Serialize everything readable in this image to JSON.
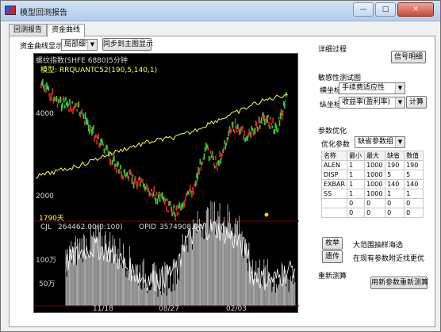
{
  "window": {
    "title": "模型回测报告",
    "minimize": "—",
    "maximize": "□",
    "close": "✕"
  },
  "tabs": [
    {
      "label": "回测报告"
    },
    {
      "label": "资金曲线"
    }
  ],
  "toolbar": {
    "display_label": "资金曲线显示",
    "display_select": "局部细节",
    "sync_button": "同步到主图显示"
  },
  "chart": {
    "title": "螺纹指数(SHFE 6880)5分钟",
    "model_label": "模型: RRQUANTC52(190,5,140,1)",
    "y_ticks": [
      "4000",
      "2000"
    ],
    "days_label": "1790天",
    "cjl_label": "CJL",
    "cjl_value": "264462.00(0:100)",
    "opid_label": "OPID",
    "opid_value": "3574908.00",
    "vol_ticks": [
      "100万",
      "50万"
    ],
    "x_ticks": [
      "11/18",
      "08/27",
      "02/03"
    ],
    "colors": {
      "price_up": "#2ad83a",
      "price_down": "#e02a2a",
      "equity": "#ffff3c",
      "volume": "#ffffff",
      "volume_fill": "#bdbdbd"
    }
  },
  "right": {
    "detail_title": "详细过程",
    "signal_button": "信号明细",
    "sensitivity_title": "敏感性测试图",
    "x_axis_label": "横坐标",
    "x_axis_select": "手续费适应性",
    "y_axis_label": "纵坐标",
    "y_axis_select": "收益率(盈利率)",
    "calc_button": "计算",
    "param_opt_title": "参数优化",
    "opt_param_label": "优化参数",
    "opt_param_select": "缺省参数组",
    "table": {
      "headers": [
        "名称",
        "最小",
        "最大",
        "缺省",
        "数值"
      ],
      "rows": [
        [
          "ALEN",
          "1",
          "1000",
          "190",
          "190"
        ],
        [
          "DISP",
          "1",
          "1000",
          "5",
          "5"
        ],
        [
          "EXBAR",
          "1",
          "1000",
          "140",
          "140"
        ],
        [
          "SS",
          "1",
          "1000",
          "1",
          "1"
        ],
        [
          "",
          "0",
          "0",
          "0",
          "0"
        ],
        [
          "",
          "0",
          "0",
          "0",
          "0"
        ]
      ]
    },
    "exhaust_button": "枚举",
    "exhaust_text": "大范围抽样海选",
    "inherit_button": "遗传",
    "inherit_text": "在现有参数附近找更优",
    "recalc_title": "重新测算",
    "recalc_button": "用新参数重新测算"
  }
}
